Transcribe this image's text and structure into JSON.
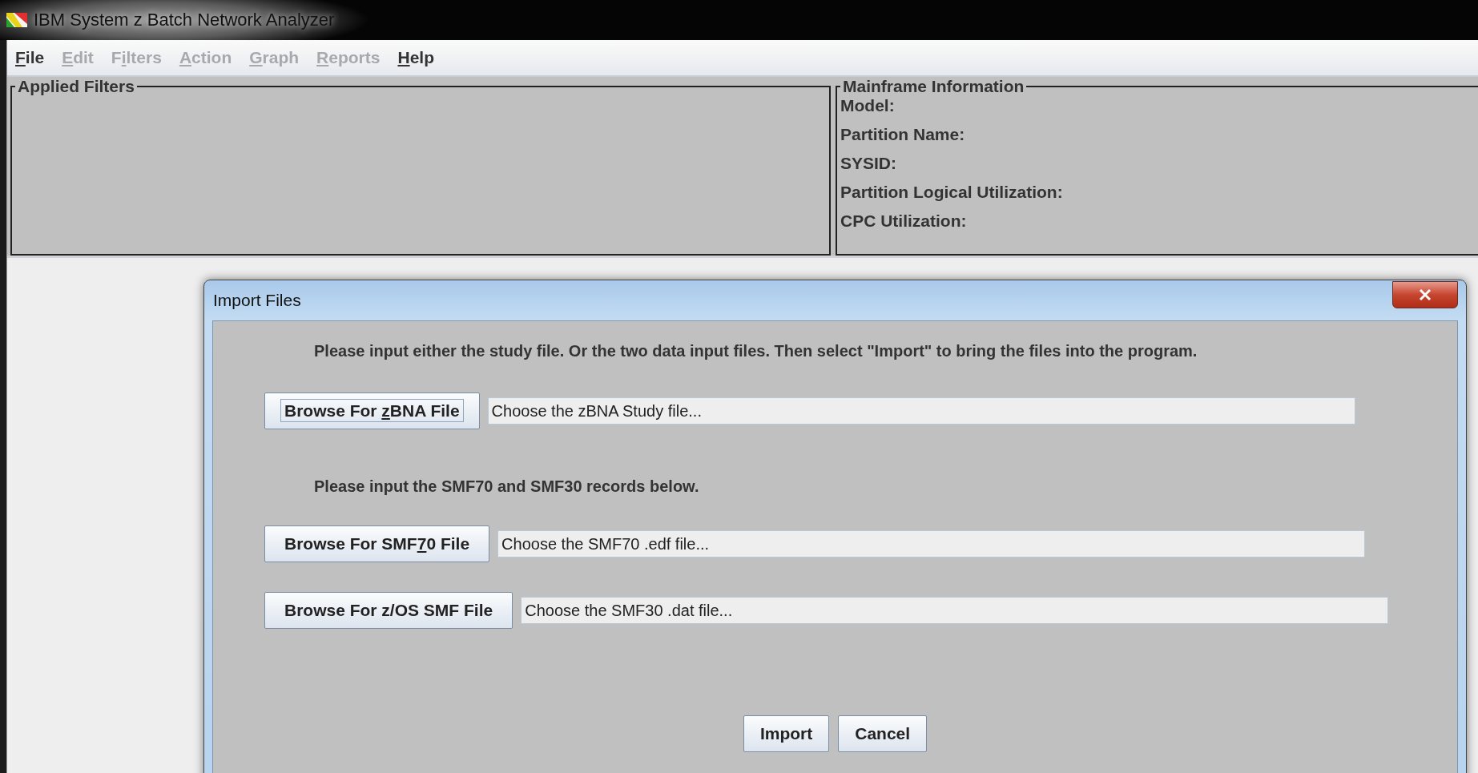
{
  "window": {
    "title": "IBM System z Batch Network Analyzer"
  },
  "menu": [
    {
      "key": "F",
      "rest": "ile",
      "disabled": false
    },
    {
      "key": "E",
      "rest": "dit",
      "disabled": true
    },
    {
      "before": "F",
      "key": "i",
      "rest": "lters",
      "disabled": true
    },
    {
      "key": "A",
      "rest": "ction",
      "disabled": true
    },
    {
      "key": "G",
      "rest": "raph",
      "disabled": true
    },
    {
      "key": "R",
      "rest": "eports",
      "disabled": true
    },
    {
      "key": "H",
      "rest": "elp",
      "disabled": false
    }
  ],
  "applied_filters": {
    "title": "Applied Filters"
  },
  "mainframe_information": {
    "title": "Mainframe Information",
    "fields": [
      "Model:",
      "Partition Name:",
      "SYSID:",
      "Partition Logical Utilization:",
      "CPC Utilization:"
    ]
  },
  "dialog": {
    "title": "Import Files",
    "instruction": "Please input either the study file. Or the two data input files. Then select \"Import\" to bring the files into the program.",
    "study": {
      "button": {
        "before": "Browse For ",
        "key": "z",
        "rest": "BNA File",
        "focused": true
      },
      "placeholder": "Choose the zBNA Study file..."
    },
    "records_note": "Please input the SMF70 and SMF30 records below.",
    "records": [
      {
        "button": {
          "before": "Browse For SMF",
          "key": "7",
          "rest": "0 File",
          "focused": false
        },
        "placeholder": "Choose the SMF70 .edf file..."
      },
      {
        "button": {
          "before": "Browse For z/OS SMF File",
          "focused": false
        },
        "placeholder": "Choose the SMF30 .dat file..."
      }
    ],
    "buttons": [
      "Import",
      "Cancel"
    ]
  }
}
